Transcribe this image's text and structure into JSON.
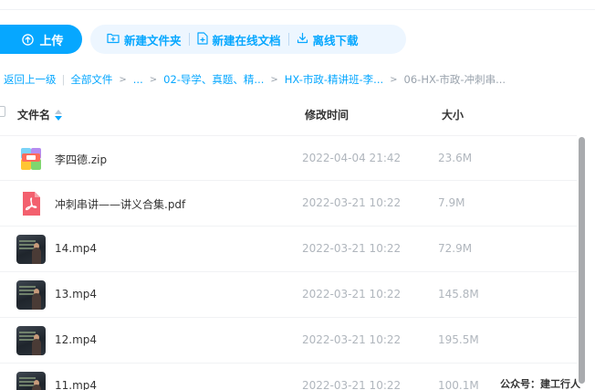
{
  "toolbar": {
    "upload_label": "上传",
    "new_folder_label": "新建文件夹",
    "new_doc_label": "新建在线文档",
    "offline_download_label": "离线下载"
  },
  "breadcrumb": {
    "back_label": "返回上一级",
    "root_label": "全部文件",
    "ellipsis_label": "...",
    "items": [
      "02-导学、真题、精...",
      "HX-市政-精讲班-李...",
      "06-HX-市政-冲刺串..."
    ]
  },
  "table": {
    "columns": {
      "name": "文件名",
      "modified": "修改时间",
      "size": "大小"
    },
    "rows": [
      {
        "name": "李四德.zip",
        "modified": "2022-04-04 21:42",
        "size": "23.6M",
        "type": "zip-icon"
      },
      {
        "name": "冲刺串讲——讲义合集.pdf",
        "modified": "2022-03-21 10:22",
        "size": "7.9M",
        "type": "pdf-icon"
      },
      {
        "name": "14.mp4",
        "modified": "2022-03-21 10:22",
        "size": "72.9M",
        "type": "video-thumbnail"
      },
      {
        "name": "13.mp4",
        "modified": "2022-03-21 10:22",
        "size": "145.8M",
        "type": "video-thumbnail"
      },
      {
        "name": "12.mp4",
        "modified": "2022-03-21 10:22",
        "size": "195.5M",
        "type": "video-thumbnail"
      },
      {
        "name": "11.mp4",
        "modified": "2022-03-21 10:22",
        "size": "100.1M",
        "type": "video-thumbnail"
      }
    ]
  },
  "watermark": "公众号：建工行人",
  "colors": {
    "accent": "#06a7ff",
    "toolbar_bg": "#edf6ff",
    "muted_text": "#b0b6bd",
    "pdf_red": "#f3606e"
  }
}
